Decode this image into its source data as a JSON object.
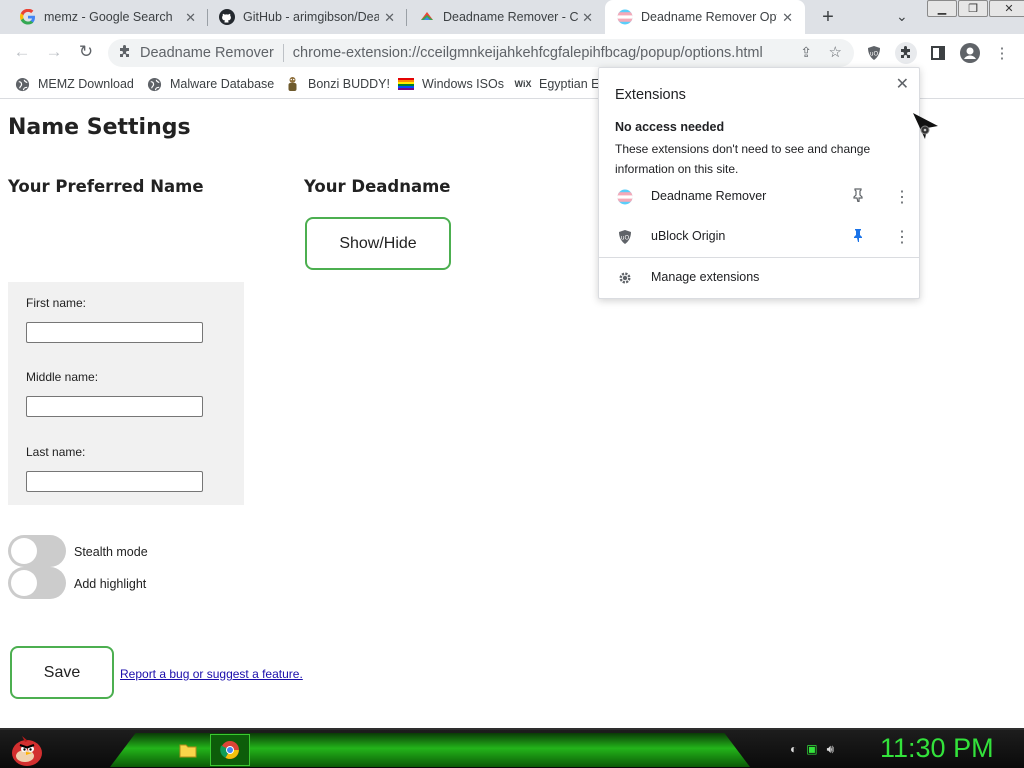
{
  "colors": {
    "accent_green": "#4caf50",
    "chrome_frame": "#dee1e6",
    "link": "#1a0dab",
    "pin_blue": "#1a73e8",
    "clock_green": "#33e23b"
  },
  "tabs": [
    {
      "label": "memz - Google Search",
      "icon": "google-icon"
    },
    {
      "label": "GitHub - arimgibson/Dea",
      "icon": "github-icon"
    },
    {
      "label": "Deadname Remover - Ch",
      "icon": "chrome-store-icon"
    },
    {
      "label": "Deadname Remover Opt",
      "icon": "trans-flag-icon",
      "active": true
    }
  ],
  "toolbar": {
    "site_name": "Deadname Remover",
    "url": "chrome-extension://cceilgmnkeijahkehfcgfalepihfbcag/popup/options.html"
  },
  "bookmarks": [
    {
      "label": "MEMZ Download",
      "icon": "globe-icon"
    },
    {
      "label": "Malware Database",
      "icon": "globe-icon"
    },
    {
      "label": "Bonzi BUDDY!",
      "icon": "bonzi-icon"
    },
    {
      "label": "Windows ISOs",
      "icon": "rainbow-flag-icon"
    },
    {
      "label": "Egyptian Er",
      "icon": "wix-icon"
    }
  ],
  "page": {
    "title": "Name Settings",
    "preferred_heading": "Your Preferred Name",
    "deadname_heading": "Your Deadname",
    "show_hide_label": "Show/Hide",
    "first_label": "First name:",
    "middle_label": "Middle name:",
    "last_label": "Last name:",
    "first_value": "",
    "middle_value": "",
    "last_value": "",
    "toggles": [
      {
        "label": "Stealth mode",
        "on": false
      },
      {
        "label": "Add highlight",
        "on": false
      }
    ],
    "save_label": "Save",
    "bug_link": "Report a bug or suggest a feature."
  },
  "extensions_popup": {
    "title": "Extensions",
    "section_header": "No access needed",
    "section_desc": "These extensions don't need to see and change information on this site.",
    "items": [
      {
        "name": "Deadname Remover",
        "icon": "trans-flag-icon",
        "pinned": false
      },
      {
        "name": "uBlock Origin",
        "icon": "ublock-icon",
        "pinned": true
      }
    ],
    "manage_label": "Manage extensions"
  },
  "taskbar": {
    "clock": "11:30 PM"
  }
}
